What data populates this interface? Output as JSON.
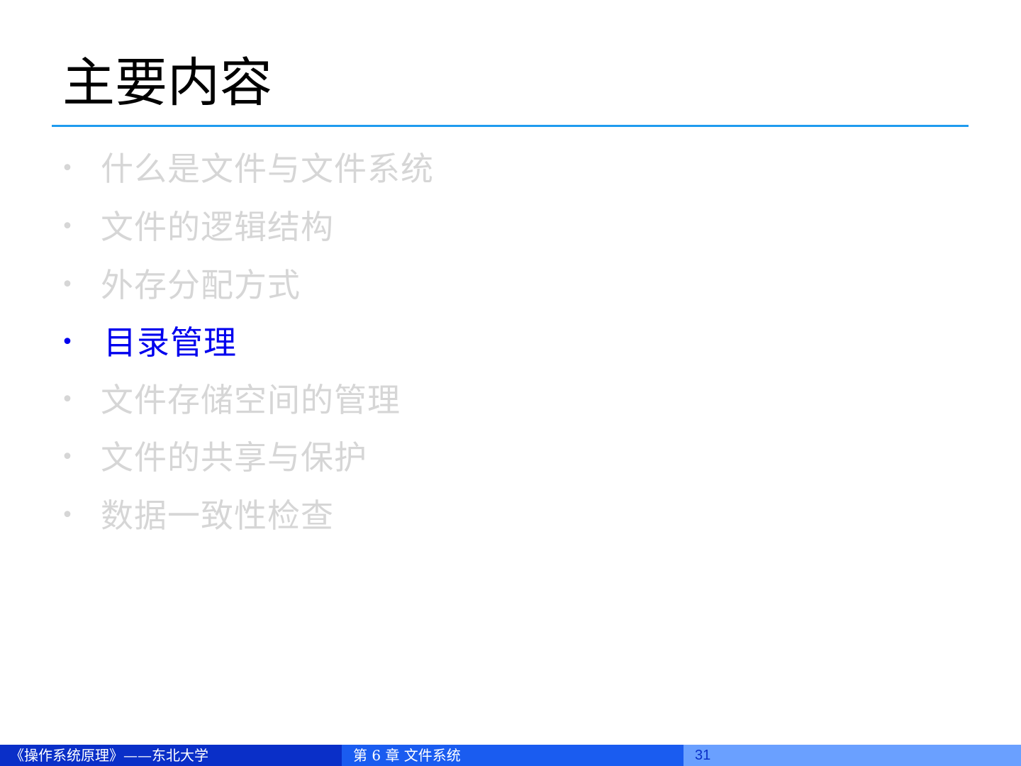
{
  "slide": {
    "title": "主要内容",
    "rule_color": "#1f9bef"
  },
  "outline": {
    "bullet_symbol": "•",
    "active_color": "#0000ee",
    "inactive_color": "#d6d6d6",
    "items": [
      {
        "label": "什么是文件与文件系统",
        "active": false
      },
      {
        "label": "文件的逻辑结构",
        "active": false
      },
      {
        "label": "外存分配方式",
        "active": false
      },
      {
        "label": "目录管理",
        "active": true
      },
      {
        "label": "文件存储空间的管理",
        "active": false
      },
      {
        "label": "文件的共享与保护",
        "active": false
      },
      {
        "label": "数据一致性检查",
        "active": false
      }
    ]
  },
  "footer": {
    "course": "《操作系统原理》——东北大学",
    "chapter": "第 6 章  文件系统",
    "page_number": "31",
    "colors": {
      "left_bg": "#0a2fc8",
      "mid_bg": "#1a5cf0",
      "right_bg": "#6aa0ff",
      "right_text": "#0a2fc8"
    }
  }
}
